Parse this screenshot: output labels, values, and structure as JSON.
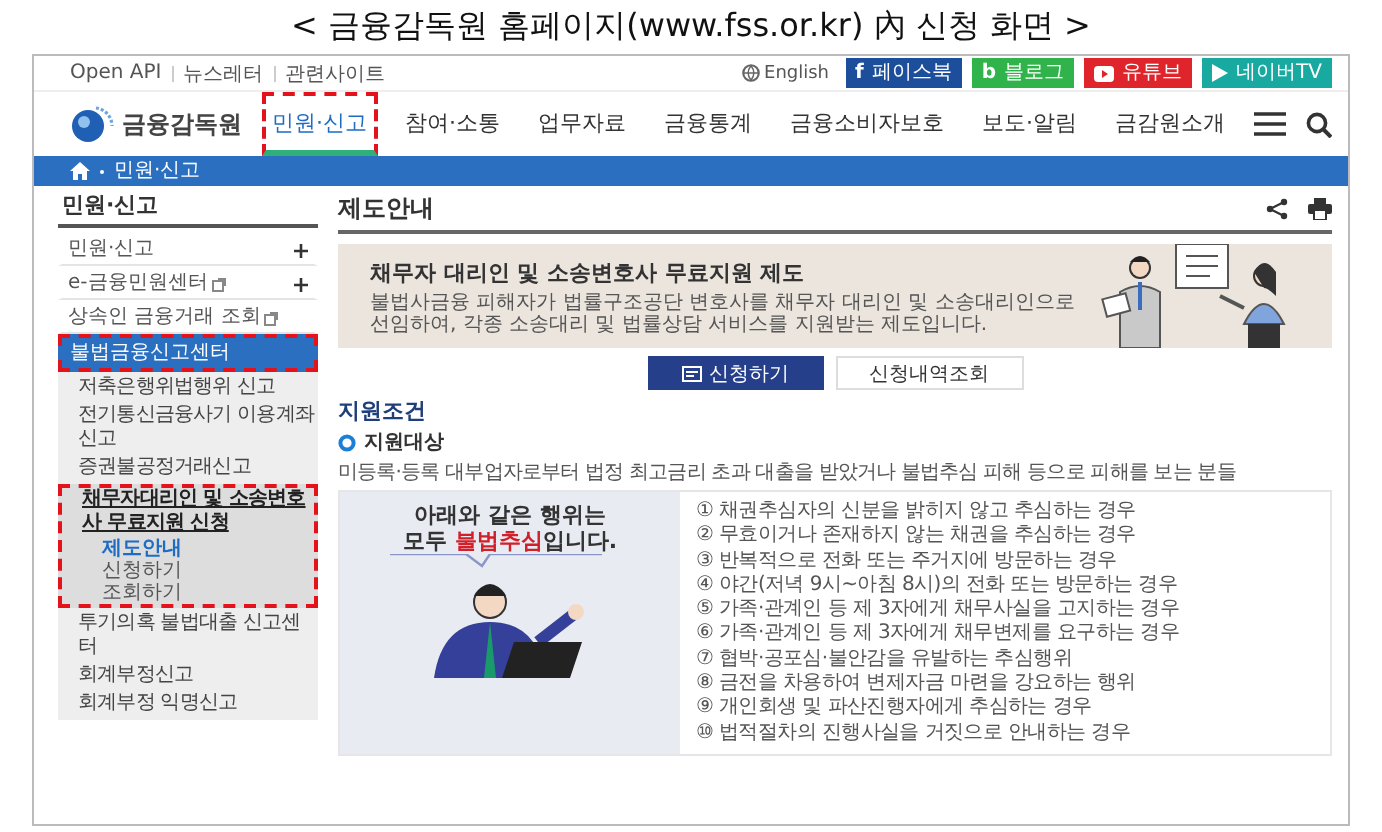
{
  "caption": "< 금융감독원 홈페이지(www.fss.or.kr) 內 신청 화면 >",
  "util_links": [
    "Open API",
    "뉴스레터",
    "관련사이트"
  ],
  "language": "English",
  "social": [
    {
      "kind": "facebook",
      "icon": "f",
      "label": "페이스북",
      "color": "#1d4e9b"
    },
    {
      "kind": "blog",
      "icon": "b",
      "label": "블로그",
      "color": "#2fb34a"
    },
    {
      "kind": "youtube",
      "label": "유튜브",
      "color": "#e0242b"
    },
    {
      "kind": "navertv",
      "label": "네이버TV",
      "color": "#18a9a0"
    }
  ],
  "logo": "금융감독원",
  "nav": [
    {
      "label": "민원·신고",
      "selected": true,
      "highlighted": true
    },
    {
      "label": "참여·소통",
      "selected": false,
      "highlighted": false
    },
    {
      "label": "업무자료",
      "selected": false,
      "highlighted": false
    },
    {
      "label": "금융통계",
      "selected": false,
      "highlighted": false
    },
    {
      "label": "금융소비자보호",
      "selected": false,
      "highlighted": false
    },
    {
      "label": "보도·알림",
      "selected": false,
      "highlighted": false
    },
    {
      "label": "금감원소개",
      "selected": false,
      "highlighted": false
    }
  ],
  "breadcrumb": "민원·신고",
  "sidebar": {
    "title": "민원·신고",
    "items": [
      {
        "label": "민원·신고",
        "selected": false,
        "highlighted": false,
        "expandable": true,
        "external": false
      },
      {
        "label": "e-금융민원센터",
        "selected": false,
        "highlighted": false,
        "expandable": true,
        "external": true
      },
      {
        "label": "상속인 금융거래 조회",
        "selected": false,
        "highlighted": false,
        "expandable": false,
        "external": true
      },
      {
        "label": "불법금융신고센터",
        "selected": true,
        "highlighted": true,
        "expandable": false,
        "external": false,
        "children": [
          {
            "label": "저축은행위법행위 신고",
            "selected": false,
            "highlighted": false
          },
          {
            "label": "전기통신금융사기 이용계좌 신고",
            "selected": false,
            "highlighted": false
          },
          {
            "label": "증권불공정거래신고",
            "selected": false,
            "highlighted": false
          },
          {
            "label": "채무자대리인 및 소송변호사 무료지원 신청",
            "selected": true,
            "highlighted": true,
            "children": [
              {
                "label": "제도안내",
                "selected": true
              },
              {
                "label": "신청하기",
                "selected": false
              },
              {
                "label": "조회하기",
                "selected": false
              }
            ]
          },
          {
            "label": "투기의혹 불법대출 신고센터",
            "selected": false,
            "highlighted": false
          },
          {
            "label": "회계부정신고",
            "selected": false,
            "highlighted": false
          },
          {
            "label": "회계부정 익명신고",
            "selected": false,
            "highlighted": false
          }
        ]
      }
    ]
  },
  "page_title": "제도안내",
  "banner": {
    "title": "채무자 대리인 및 소송변호사 무료지원 제도",
    "text": "불법사금융 피해자가 법률구조공단 변호사를 채무자 대리인 및 소송대리인으로 선임하여, 각종 소송대리 및 법률상담 서비스를 지원받는 제도입니다."
  },
  "buttons": [
    {
      "label": "신청하기",
      "kind": "primary"
    },
    {
      "label": "신청내역조회",
      "kind": "secondary"
    }
  ],
  "section_title": "지원조건",
  "subsection_title": "지원대상",
  "target_text": "미등록·등록 대부업자로부터 법정 최고금리 초과 대출을 받았거나 불법추심 피해 등으로 피해를 보는 분들",
  "bubble": [
    "아래와 같은 행위는",
    "모두 **불법추심**입니다."
  ],
  "acts": [
    "① 채권추심자의 신분을 밝히지 않고 추심하는 경우",
    "② 무효이거나 존재하지 않는 채권을 추심하는 경우",
    "③ 반복적으로 전화 또는 주거지에 방문하는 경우",
    "④ 야간(저녁 9시~아침 8시)의 전화 또는 방문하는 경우",
    "⑤ 가족·관계인 등 제 3자에게 채무사실을 고지하는 경우",
    "⑥ 가족·관계인 등 제 3자에게 채무변제를 요구하는 경우",
    "⑦ 협박·공포심·불안감을 유발하는 추심행위",
    "⑧ 금전을 차용하여 변제자금 마련을 강요하는 행위",
    "⑨ 개인회생 및 파산진행자에게 추심하는 경우",
    "⑩ 법적절차의 진행사실을 거짓으로 안내하는 경우"
  ]
}
